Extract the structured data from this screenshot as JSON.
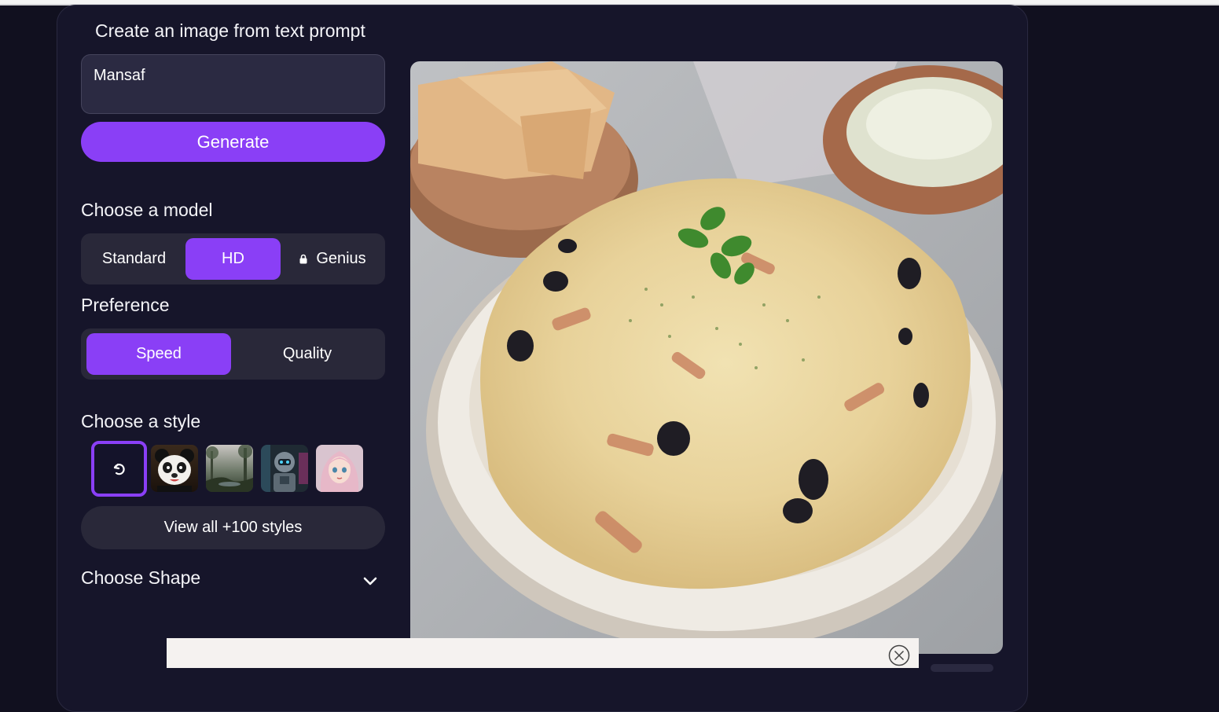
{
  "page": {
    "title": "Create an image from text prompt"
  },
  "prompt": {
    "value": "Mansaf",
    "placeholder": ""
  },
  "generate_button": "Generate",
  "model": {
    "label": "Choose a model",
    "options": [
      "Standard",
      "HD",
      "Genius"
    ],
    "selected": "HD",
    "locked": [
      "Genius"
    ]
  },
  "preference": {
    "label": "Preference",
    "options": [
      "Speed",
      "Quality"
    ],
    "selected": "Speed"
  },
  "style": {
    "label": "Choose a style",
    "thumbnails": [
      "no-style-icon",
      "panda-style",
      "landscape-style",
      "robot-style",
      "anime-girl-style"
    ],
    "selected": "no-style-icon",
    "view_all": "View all +100 styles"
  },
  "shape": {
    "label": "Choose Shape",
    "icon": "chevron-down-icon"
  },
  "result": {
    "subject": "generated-image"
  },
  "colors": {
    "accent": "#8a3ff6",
    "background": "#11101f",
    "panel": "#16152a",
    "control": "#292839"
  }
}
